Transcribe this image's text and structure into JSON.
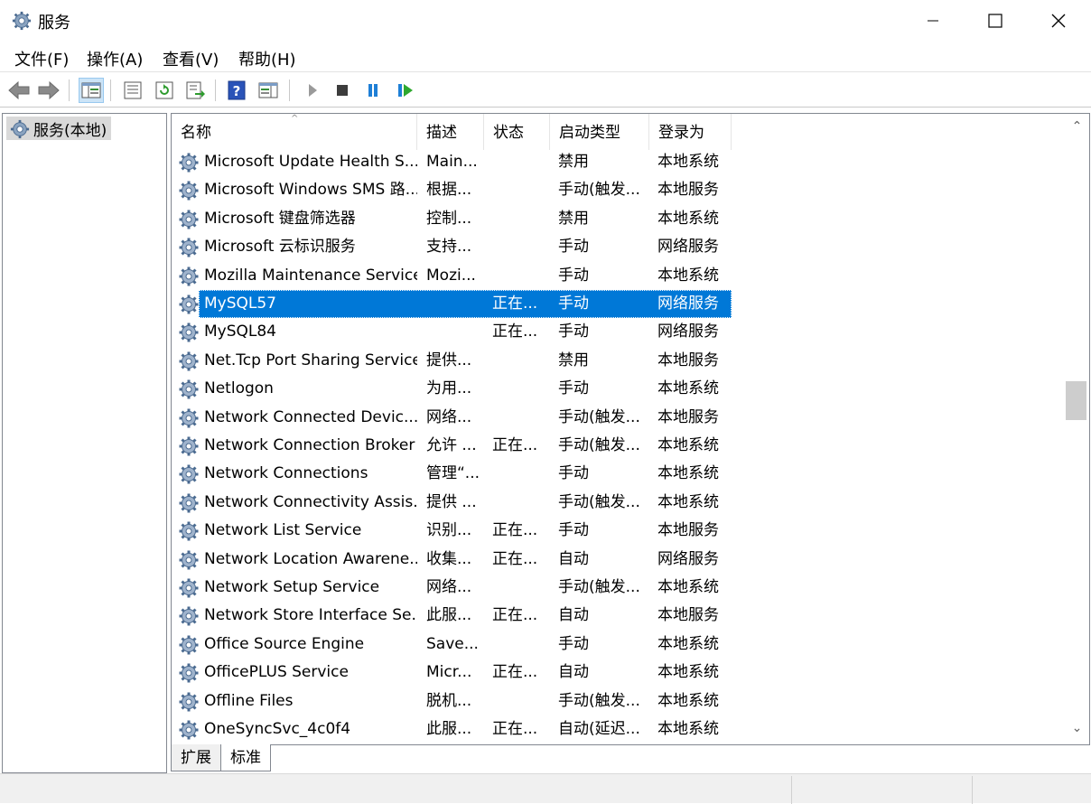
{
  "window": {
    "title": "服务",
    "icon": "gear-icon"
  },
  "menu": [
    "文件(F)",
    "操作(A)",
    "查看(V)",
    "帮助(H)"
  ],
  "toolbar": {
    "buttons": [
      "back-icon",
      "forward-icon",
      "show-hide-console-tree-icon",
      "properties-icon",
      "refresh-icon",
      "export-list-icon",
      "help-icon",
      "action-pane-icon",
      "start-service-icon",
      "stop-service-icon",
      "pause-service-icon",
      "resume-service-icon"
    ]
  },
  "tree": {
    "root_label": "服务(本地)"
  },
  "columns": [
    "名称",
    "描述",
    "状态",
    "启动类型",
    "登录为"
  ],
  "services": [
    {
      "name": "Microsoft Update Health S...",
      "desc": "Main...",
      "status": "",
      "startup": "禁用",
      "logon": "本地系统"
    },
    {
      "name": "Microsoft Windows SMS 路...",
      "desc": "根据...",
      "status": "",
      "startup": "手动(触发...",
      "logon": "本地服务"
    },
    {
      "name": "Microsoft 键盘筛选器",
      "desc": "控制...",
      "status": "",
      "startup": "禁用",
      "logon": "本地系统"
    },
    {
      "name": "Microsoft 云标识服务",
      "desc": "支持...",
      "status": "",
      "startup": "手动",
      "logon": "网络服务"
    },
    {
      "name": "Mozilla Maintenance Service",
      "desc": "Mozi...",
      "status": "",
      "startup": "手动",
      "logon": "本地系统"
    },
    {
      "name": "MySQL57",
      "desc": "",
      "status": "正在...",
      "startup": "手动",
      "logon": "网络服务",
      "selected": true
    },
    {
      "name": "MySQL84",
      "desc": "",
      "status": "正在...",
      "startup": "手动",
      "logon": "网络服务"
    },
    {
      "name": "Net.Tcp Port Sharing Service",
      "desc": "提供...",
      "status": "",
      "startup": "禁用",
      "logon": "本地服务"
    },
    {
      "name": "Netlogon",
      "desc": "为用...",
      "status": "",
      "startup": "手动",
      "logon": "本地系统"
    },
    {
      "name": "Network Connected Devic...",
      "desc": "网络...",
      "status": "",
      "startup": "手动(触发...",
      "logon": "本地服务"
    },
    {
      "name": "Network Connection Broker",
      "desc": "允许 ...",
      "status": "正在...",
      "startup": "手动(触发...",
      "logon": "本地系统"
    },
    {
      "name": "Network Connections",
      "desc": "管理“...",
      "status": "",
      "startup": "手动",
      "logon": "本地系统"
    },
    {
      "name": "Network Connectivity Assis...",
      "desc": "提供 ...",
      "status": "",
      "startup": "手动(触发...",
      "logon": "本地系统"
    },
    {
      "name": "Network List Service",
      "desc": "识别...",
      "status": "正在...",
      "startup": "手动",
      "logon": "本地服务"
    },
    {
      "name": "Network Location Awarene...",
      "desc": "收集...",
      "status": "正在...",
      "startup": "自动",
      "logon": "网络服务"
    },
    {
      "name": "Network Setup Service",
      "desc": "网络...",
      "status": "",
      "startup": "手动(触发...",
      "logon": "本地系统"
    },
    {
      "name": "Network Store Interface Se...",
      "desc": "此服...",
      "status": "正在...",
      "startup": "自动",
      "logon": "本地服务"
    },
    {
      "name": "Office  Source Engine",
      "desc": "Save...",
      "status": "",
      "startup": "手动",
      "logon": "本地系统"
    },
    {
      "name": "OfficePLUS Service",
      "desc": "Micr...",
      "status": "正在...",
      "startup": "自动",
      "logon": "本地系统"
    },
    {
      "name": "Offline Files",
      "desc": "脱机...",
      "status": "",
      "startup": "手动(触发...",
      "logon": "本地系统"
    },
    {
      "name": "OneSyncSvc_4c0f4",
      "desc": "此服...",
      "status": "正在...",
      "startup": "自动(延迟...",
      "logon": "本地系统"
    }
  ],
  "tabs": [
    "扩展",
    "标准"
  ]
}
